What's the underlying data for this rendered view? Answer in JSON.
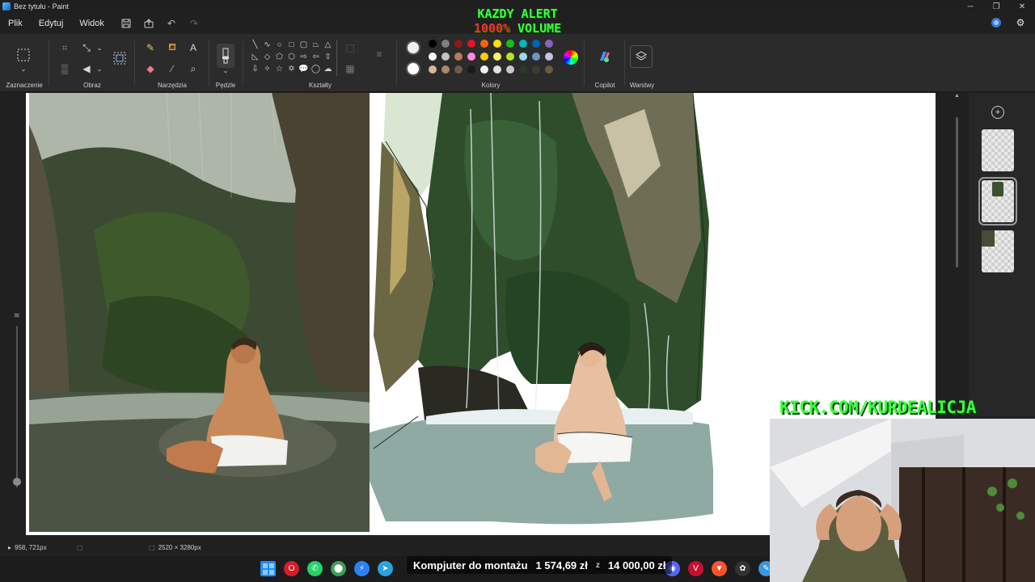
{
  "window": {
    "title": "Bez tytułu - Paint",
    "minimize": "─",
    "maximize": "❐",
    "close": "✕"
  },
  "menu": {
    "items": [
      "Plik",
      "Edytuj",
      "Widok"
    ]
  },
  "alert": {
    "line1": "KAZDY ALERT",
    "line2_red": "1000%",
    "line2_rest": " VOLUME"
  },
  "ribbon": {
    "groups": {
      "selection": "Zaznaczenie",
      "image": "Obraz",
      "tools": "Narzędzia",
      "brushes": "Pędzle",
      "shapes": "Kształty",
      "colors": "Kolory",
      "copilot": "Copilot",
      "layers": "Warstwy"
    },
    "primary_color": "#f2f0ea",
    "secondary_color": "#ffffff",
    "palette": [
      [
        "#000000",
        "#7f7f7f",
        "#8b1a1a",
        "#e81123",
        "#f7630c",
        "#fde100",
        "#15c11a",
        "#00b7c3",
        "#0063b1",
        "#8764b8"
      ],
      [
        "#ffffff",
        "#c3c3c3",
        "#b97a57",
        "#ff8ad8",
        "#ffc90e",
        "#f7f36b",
        "#b5e61d",
        "#99d9ea",
        "#7092be",
        "#c8bfe7"
      ],
      [
        "#d7b896",
        "#a98a6c",
        "#6f5b4a",
        "#1a1a1a",
        "#f2f2f2",
        "#e0e0e0",
        "#c8c8c8",
        "#2b3a2b",
        "#3b3b2f",
        "#6b5a3c"
      ]
    ]
  },
  "status": {
    "cursor_position": "958, 721px",
    "canvas_size": "2520 × 3280px"
  },
  "overlays": {
    "goal_label": "Kompjuter do montażu",
    "goal_current": "1 574,69 zł",
    "goal_sep": "z",
    "goal_target": "14 000,00 zł",
    "kick_url": "KICK.COM/KURDEALICJA"
  }
}
